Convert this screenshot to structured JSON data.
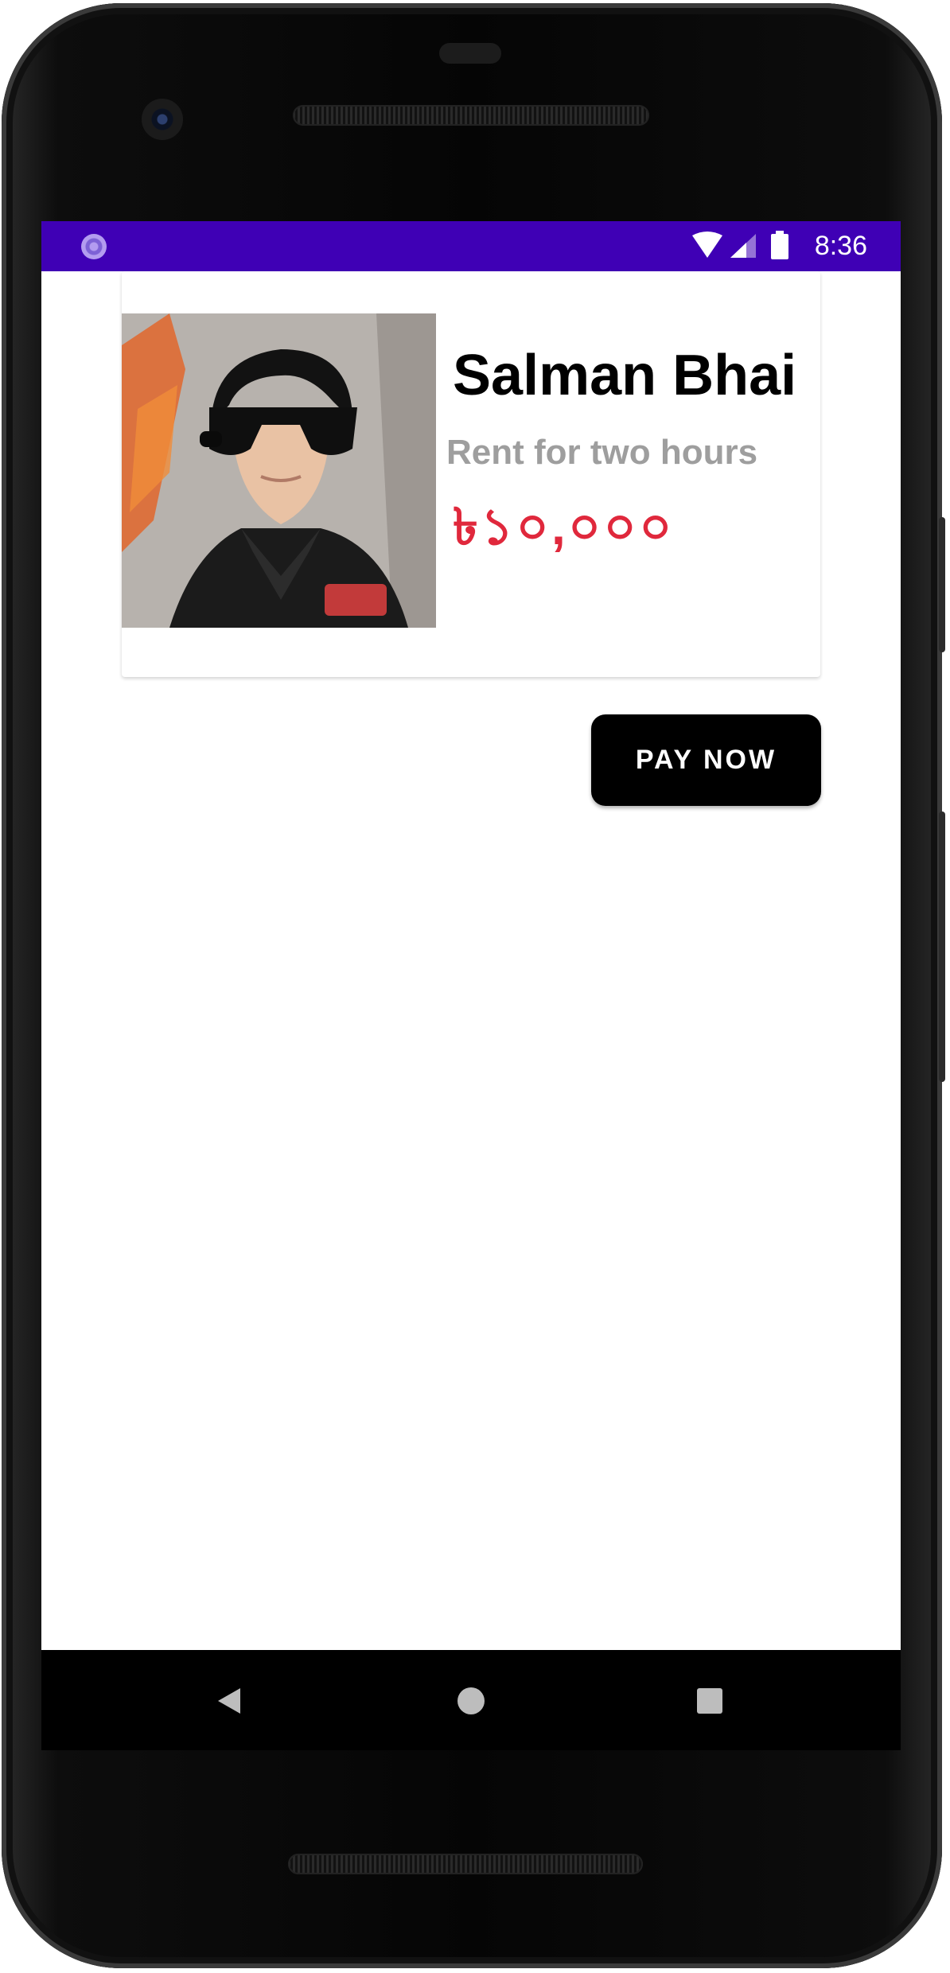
{
  "status_bar": {
    "time": "8:36",
    "background": "#3f00b5",
    "icons": [
      "app-notification-icon",
      "wifi-icon",
      "cellular-signal-icon",
      "battery-icon"
    ]
  },
  "card": {
    "name": "Salman Bhai",
    "subtitle": "Rent for two hours",
    "price": "৳১০,০০০",
    "price_color": "#e0283c"
  },
  "actions": {
    "pay_now_label": "PAY NOW"
  },
  "navigation": {
    "icons": [
      "back-icon",
      "home-icon",
      "recents-icon"
    ]
  }
}
